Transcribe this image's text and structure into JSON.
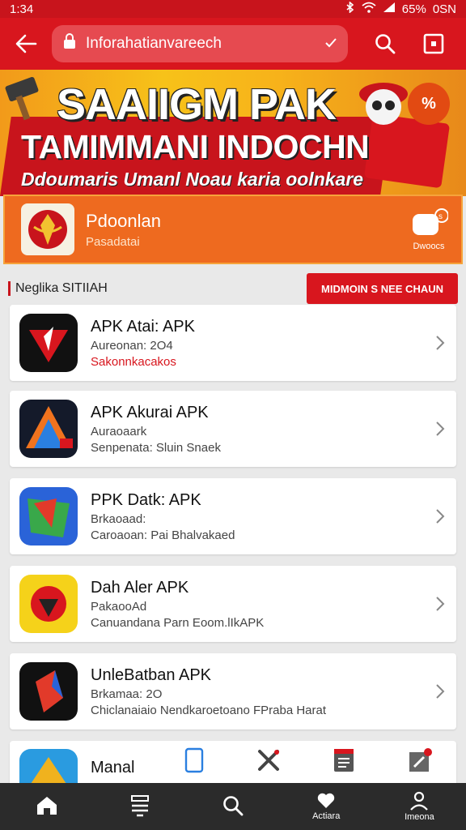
{
  "status_bar": {
    "time": "1:34",
    "battery": "65%",
    "signal_text": "0SN"
  },
  "toolbar": {
    "url": "Inforahatianvareech"
  },
  "banner": {
    "title": "SAAIIGM PAK",
    "line2": "TAMIMMANI INDOCHN",
    "line3": "Ddoumaris Umanl Noau karia oolnkare",
    "badge": "%"
  },
  "featured": {
    "title": "Pdoonlan",
    "subtitle": "Pasadatai",
    "action_label": "Dwoocs"
  },
  "section": {
    "label": "Neglika SITIIAH",
    "button_label": "MIDMOIN S NEE CHAUN"
  },
  "apps": [
    {
      "title": "APK Atai: APK",
      "meta1": "Aureonan: 2O4",
      "meta2": "Sakonnkacakos"
    },
    {
      "title": "APK Akurai APK",
      "meta1": "Auraoaark",
      "meta2": "Senpenata: Sluin Snaek"
    },
    {
      "title": "PPK Datk: APK",
      "meta1": "Brkaoaad:",
      "meta2": "Caroaoan: Pai Bhalvakaed"
    },
    {
      "title": "Dah Aler APK",
      "meta1": "PakaooAd",
      "meta2": "Canuandana Parn Eoom.lIkAPK"
    },
    {
      "title": "UnleBatban APK",
      "meta1": "Brkamaa: 2O",
      "meta2": "Chiclanaiaio Nendkaroetoano FPraba Harat"
    },
    {
      "title": "Manal",
      "meta1": "",
      "meta2": ""
    }
  ],
  "bottom_nav": [
    {
      "label": ""
    },
    {
      "label": ""
    },
    {
      "label": ""
    },
    {
      "label": "Actiara"
    },
    {
      "label": "Imeona"
    }
  ]
}
